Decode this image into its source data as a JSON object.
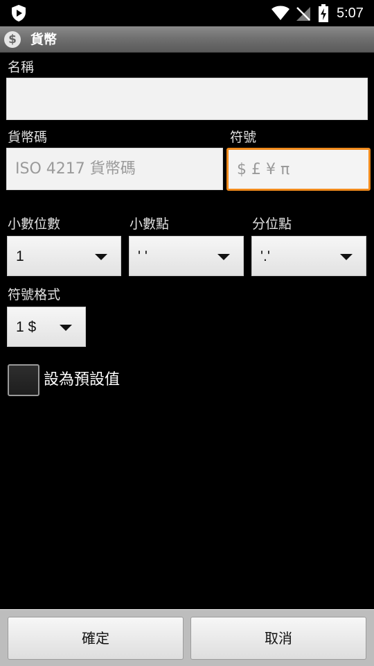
{
  "status_bar": {
    "time": "5:07",
    "icons": [
      "shield-play-icon",
      "wifi-icon",
      "no-signal-icon",
      "battery-charging-icon"
    ]
  },
  "title_bar": {
    "icon": "dollar-icon",
    "icon_glyph": "$",
    "title": "貨幣"
  },
  "form": {
    "name_label": "名稱",
    "name_value": "",
    "code_label": "貨幣碼",
    "code_placeholder": "ISO 4217 貨幣碼",
    "symbol_label": "符號",
    "symbol_placeholder": "$ £ ¥ π",
    "decimals_label": "小數位數",
    "decimals_value": "1",
    "decimal_point_label": "小數點",
    "decimal_point_value": "' '",
    "group_sep_label": "分位點",
    "group_sep_value": "'.'",
    "symbol_format_label": "符號格式",
    "symbol_format_value": "1 $",
    "default_checkbox_label": "設為預設值",
    "default_checked": false
  },
  "buttons": {
    "ok": "確定",
    "cancel": "取消"
  },
  "colors": {
    "focus": "#f08a1c",
    "title_bar": "#6e6e6e"
  }
}
